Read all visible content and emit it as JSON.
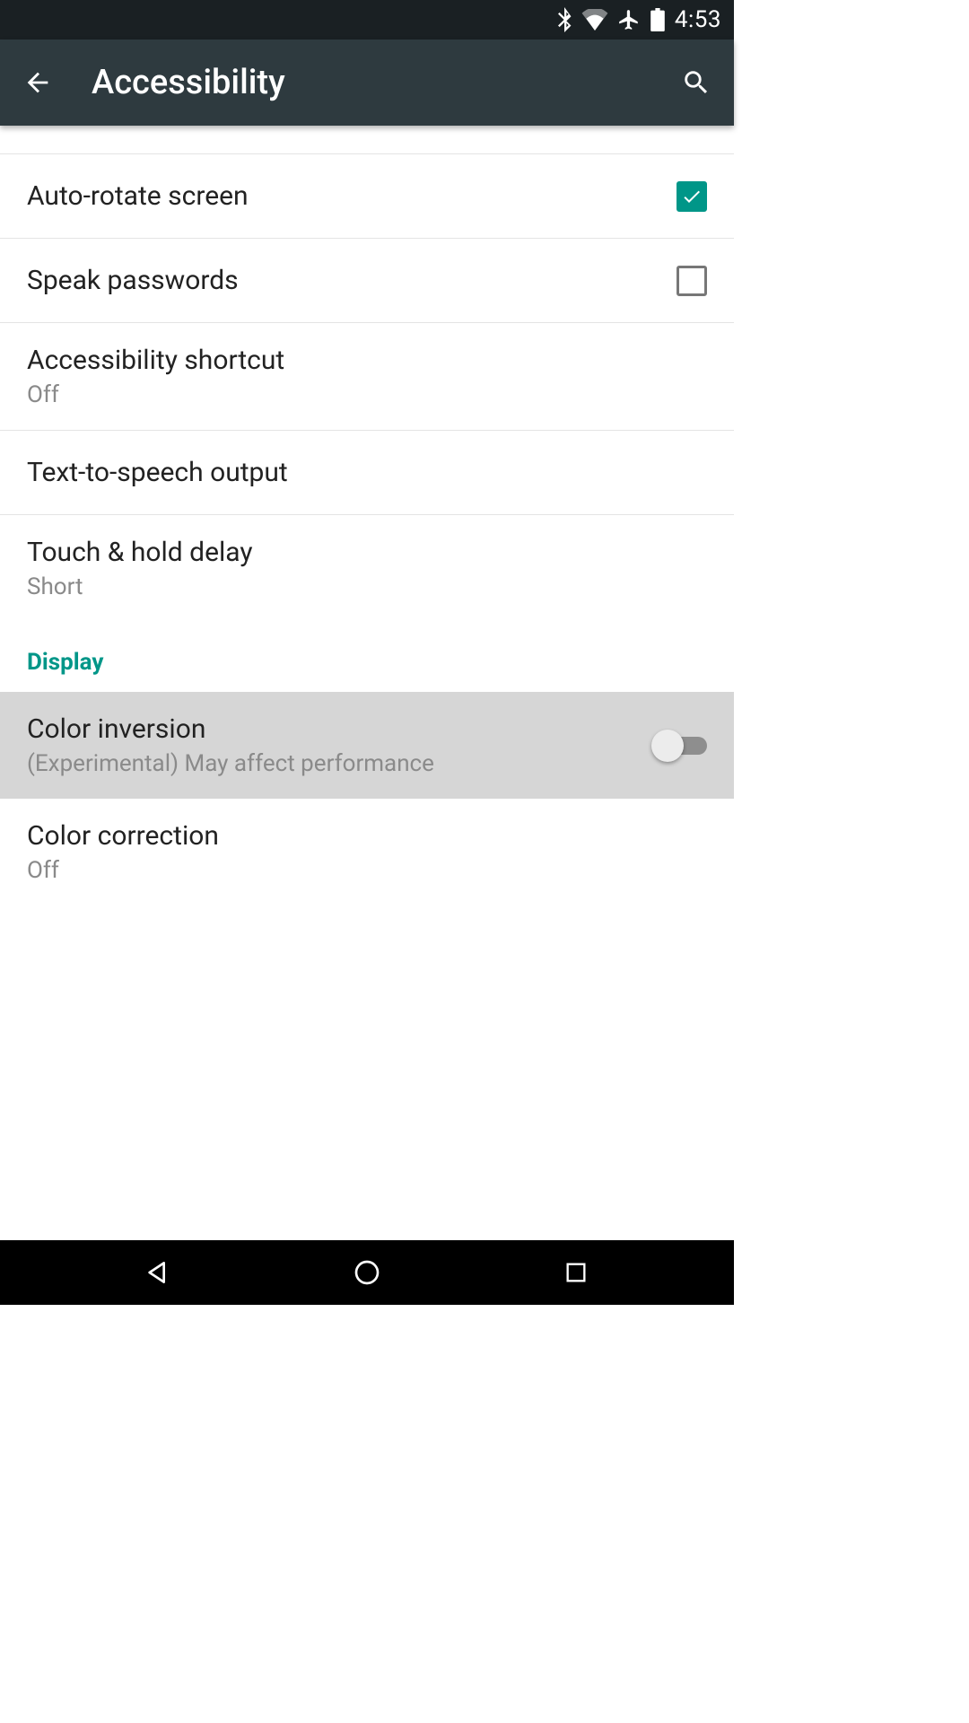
{
  "status": {
    "time": "4:53"
  },
  "appbar": {
    "title": "Accessibility"
  },
  "rows": {
    "auto_rotate": {
      "label": "Auto-rotate screen",
      "checked": true
    },
    "speak_passwords": {
      "label": "Speak passwords",
      "checked": false
    },
    "accessibility_shortcut": {
      "label": "Accessibility shortcut",
      "value": "Off"
    },
    "tts": {
      "label": "Text-to-speech output"
    },
    "touch_hold": {
      "label": "Touch & hold delay",
      "value": "Short"
    },
    "section_display": "Display",
    "color_inversion": {
      "label": "Color inversion",
      "value": "(Experimental) May affect performance",
      "on": false
    },
    "color_correction": {
      "label": "Color correction",
      "value": "Off"
    }
  }
}
